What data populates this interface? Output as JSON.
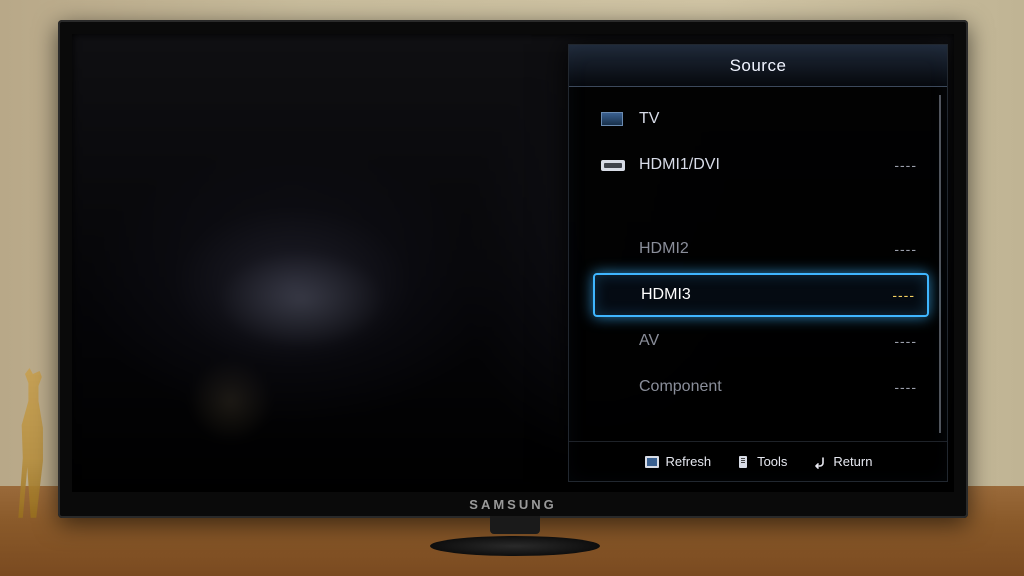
{
  "tv_brand": "SAMSUNG",
  "menu": {
    "title": "Source",
    "selected_index": 3,
    "items": [
      {
        "label": "TV",
        "status": "",
        "icon": "tv",
        "active": true
      },
      {
        "label": "HDMI1/DVI",
        "status": "----",
        "icon": "hdmi",
        "active": true
      },
      {
        "label": "HDMI2",
        "status": "----",
        "icon": "",
        "active": false
      },
      {
        "label": "HDMI3",
        "status": "----",
        "icon": "",
        "active": false
      },
      {
        "label": "AV",
        "status": "----",
        "icon": "",
        "active": false
      },
      {
        "label": "Component",
        "status": "----",
        "icon": "",
        "active": false
      }
    ],
    "footer": {
      "refresh": "Refresh",
      "tools": "Tools",
      "return": "Return"
    }
  }
}
